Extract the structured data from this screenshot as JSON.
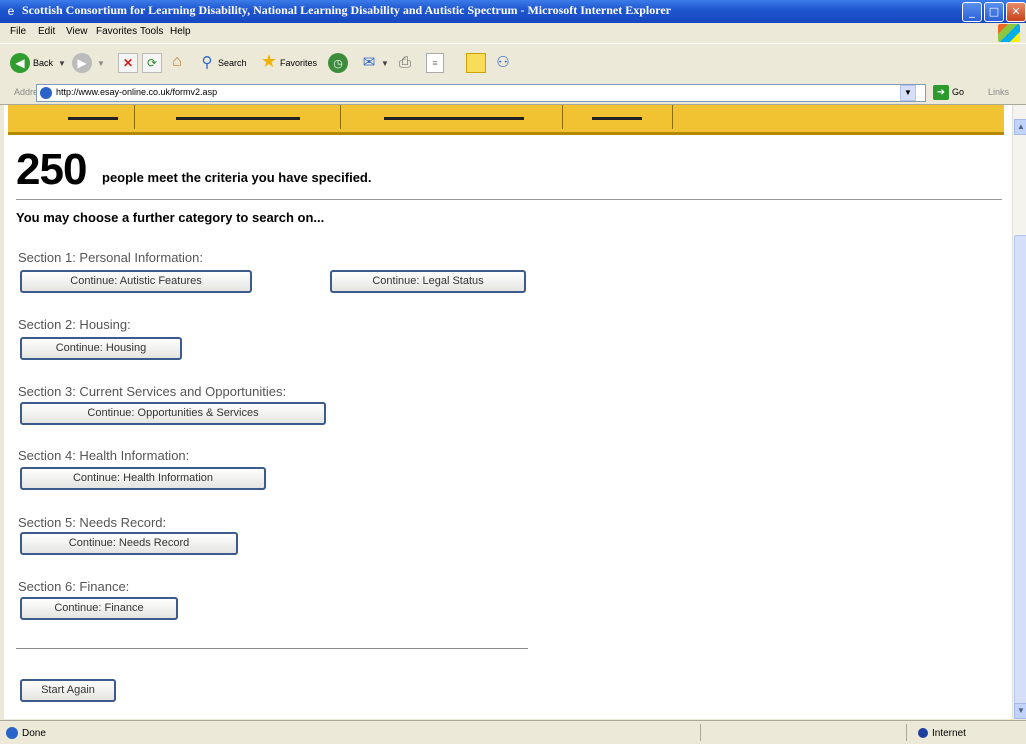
{
  "window": {
    "title": "Scottish Consortium for Learning Disability, National Learning Disability and Autistic Spectrum - Microsoft Internet Explorer",
    "minimize_glyph": "_",
    "maximize_glyph": "□",
    "close_glyph": "✕"
  },
  "menu": [
    "File",
    "Edit",
    "View",
    "Favorites",
    "Tools",
    "Help"
  ],
  "toolbar": {
    "back_label": "Back",
    "search_label": "Search",
    "favorites_label": "Favorites"
  },
  "address": {
    "label": "Address",
    "url": "http://www.esay-online.co.uk/formv2.asp",
    "go_label": "Go",
    "links_label": "Links"
  },
  "page": {
    "count": "250",
    "count_text": "people meet the criteria you have specified.",
    "prompt": "You may choose a further category to search on...",
    "sections": [
      {
        "label": "Section 1: Personal Information:",
        "buttons": [
          "Continue: Autistic Features",
          "Continue: Legal Status"
        ]
      },
      {
        "label": "Section 2: Housing:",
        "buttons": [
          "Continue: Housing"
        ]
      },
      {
        "label": "Section 3: Current Services and Opportunities:",
        "buttons": [
          "Continue: Opportunities & Services"
        ]
      },
      {
        "label": "Section 4: Health Information:",
        "buttons": [
          "Continue: Health Information"
        ]
      },
      {
        "label": "Section 5: Needs Record:",
        "buttons": [
          "Continue: Needs Record"
        ]
      },
      {
        "label": "Section 6: Finance:",
        "buttons": [
          "Continue: Finance"
        ]
      }
    ],
    "start_again": "Start Again"
  },
  "status": {
    "text": "Done",
    "zone": "Internet"
  },
  "colors": {
    "nav_strip": "#f1c232",
    "button_border": "#3c5a8c",
    "titlebar": "#1f58d0"
  }
}
